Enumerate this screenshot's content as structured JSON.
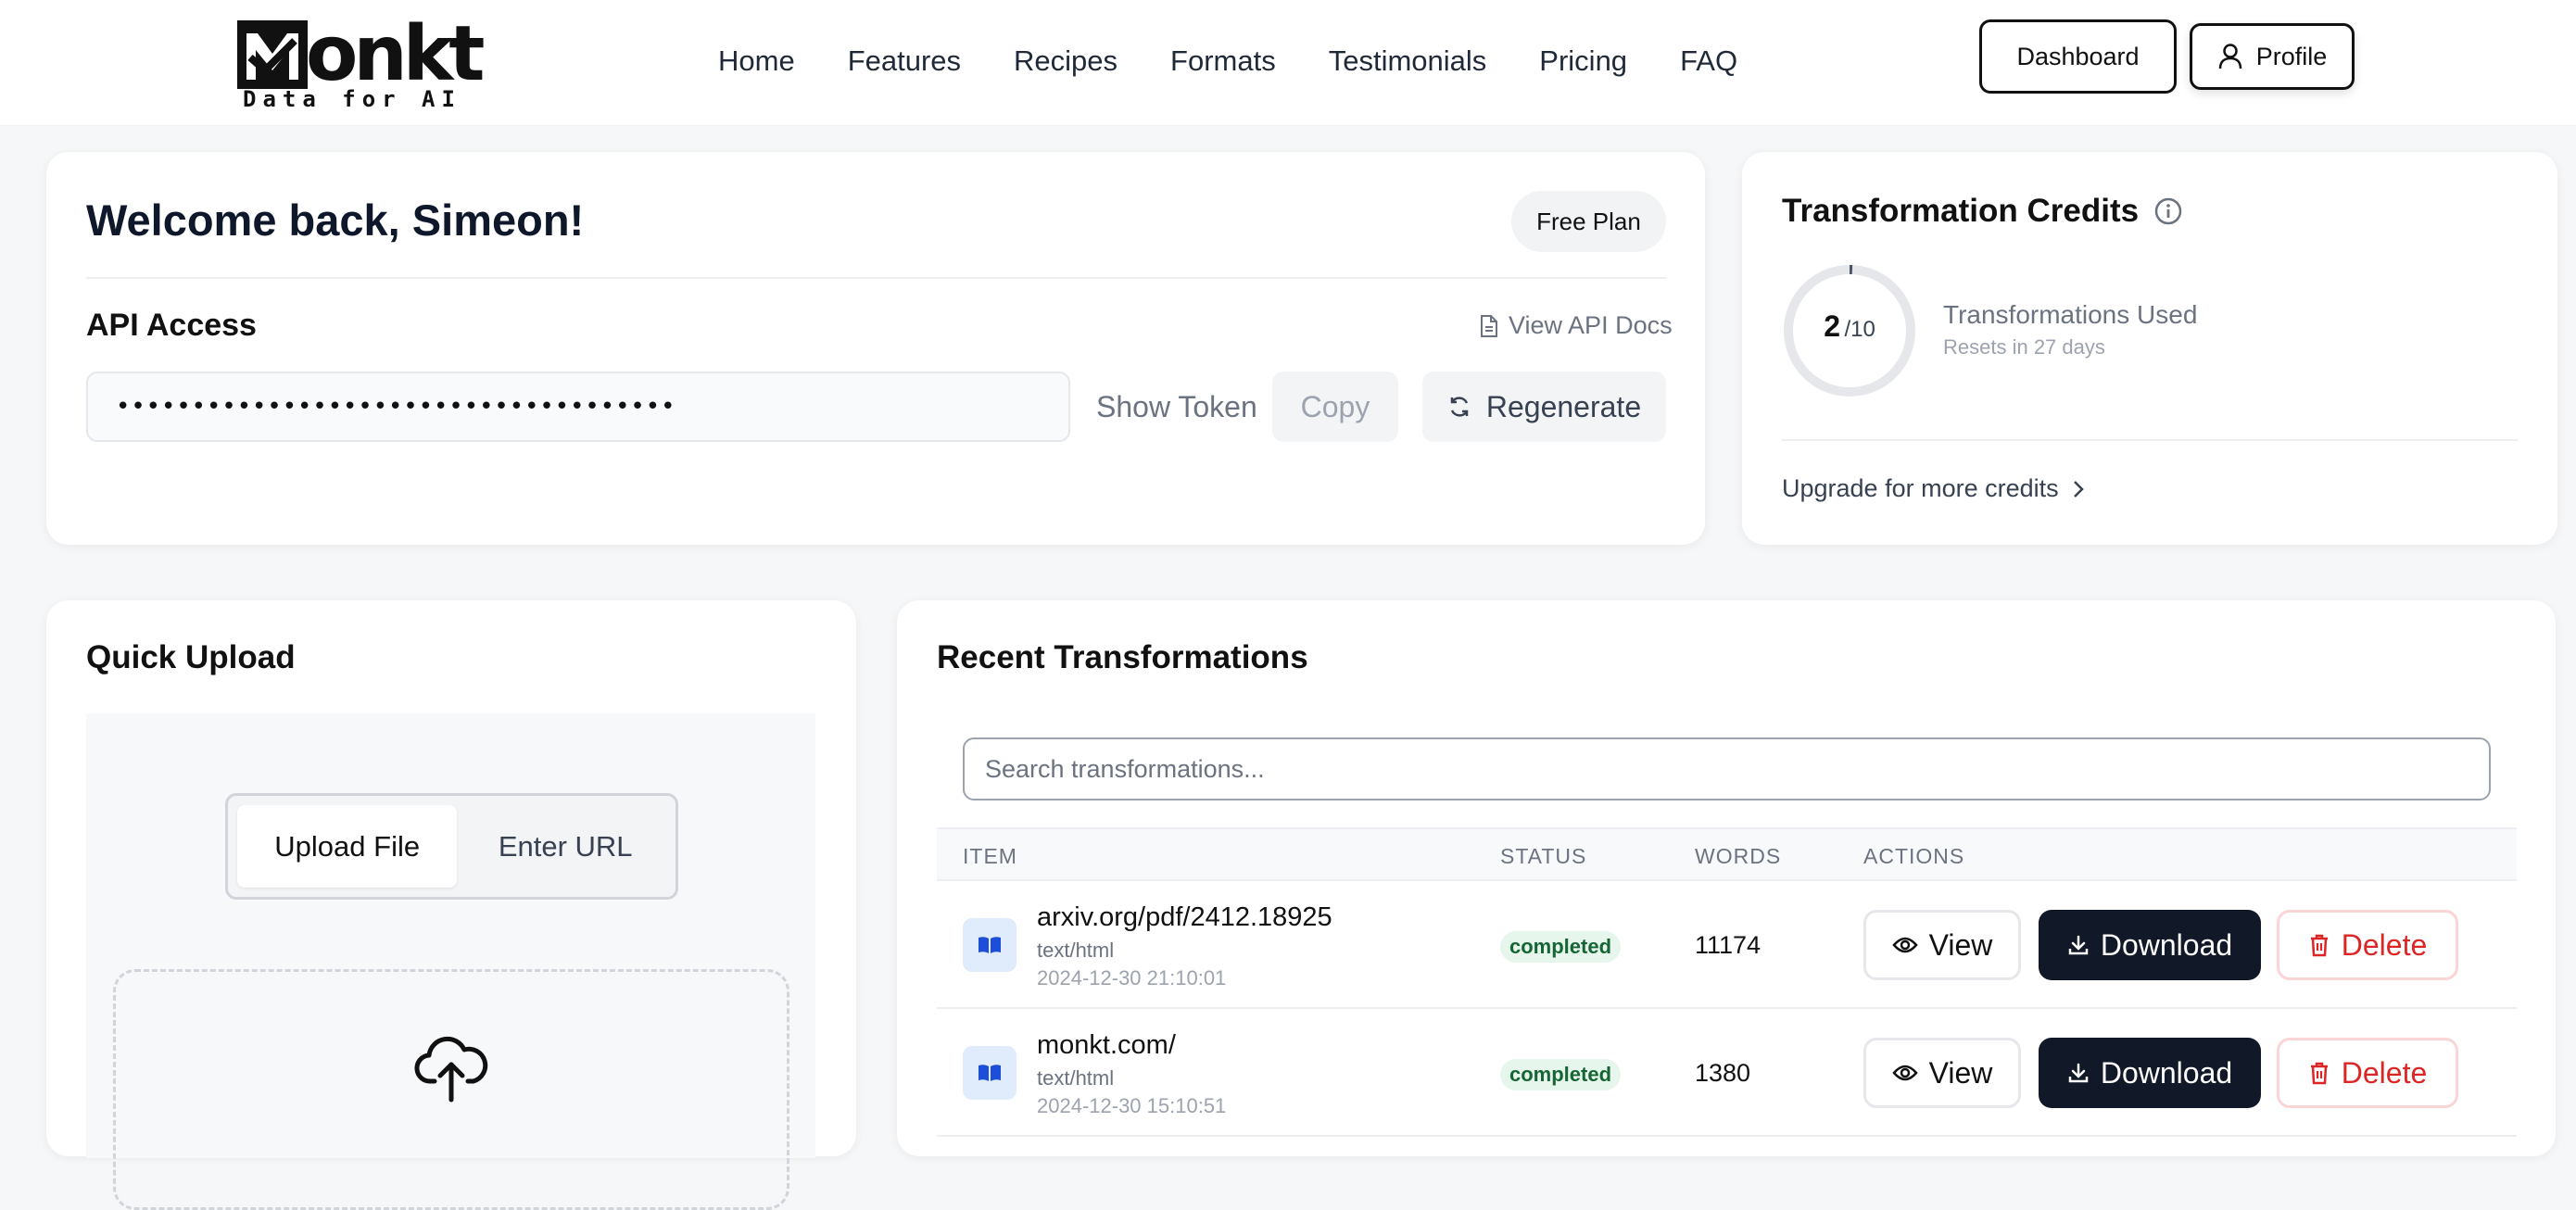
{
  "header": {
    "logo_text": "Monkt",
    "logo_rest": "onkt",
    "logo_tagline": "Data for AI",
    "nav": [
      "Home",
      "Features",
      "Recipes",
      "Formats",
      "Testimonials",
      "Pricing",
      "FAQ"
    ],
    "dashboard_label": "Dashboard",
    "profile_label": "Profile"
  },
  "welcome": {
    "title": "Welcome back, Simeon!",
    "plan": "Free Plan",
    "api_title": "API Access",
    "api_docs_label": "View API Docs",
    "token_masked": "•••••••••••••••••••••••••••••••••••••",
    "show_token_label": "Show Token",
    "copy_label": "Copy",
    "regenerate_label": "Regenerate"
  },
  "credits": {
    "title": "Transformation Credits",
    "used": "2",
    "total": "/10",
    "used_fraction": 0.2,
    "used_label": "Transformations Used",
    "reset_label": "Resets in 27 days",
    "upgrade_label": "Upgrade for more credits"
  },
  "upload": {
    "title": "Quick Upload",
    "tab_file": "Upload File",
    "tab_url": "Enter URL"
  },
  "recent": {
    "title": "Recent Transformations",
    "search_placeholder": "Search transformations...",
    "columns": [
      "ITEM",
      "STATUS",
      "WORDS",
      "ACTIONS"
    ],
    "rows": [
      {
        "title": "arxiv.org/pdf/2412.18925",
        "type": "text/html",
        "date": "2024-12-30 21:10:01",
        "status": "completed",
        "words": "11174"
      },
      {
        "title": "monkt.com/",
        "type": "text/html",
        "date": "2024-12-30 15:10:51",
        "status": "completed",
        "words": "1380"
      }
    ],
    "view_label": "View",
    "download_label": "Download",
    "delete_label": "Delete"
  },
  "colors": {
    "accent_dark": "#111827",
    "status_green": "#166534",
    "delete_red": "#dc2626",
    "item_icon_blue": "#1d4ed8"
  },
  "icons": [
    "upload-cloud-icon",
    "user-icon",
    "document-icon",
    "refresh-icon",
    "info-icon",
    "chevron-right-icon",
    "book-icon",
    "eye-icon",
    "download-icon",
    "trash-icon"
  ]
}
